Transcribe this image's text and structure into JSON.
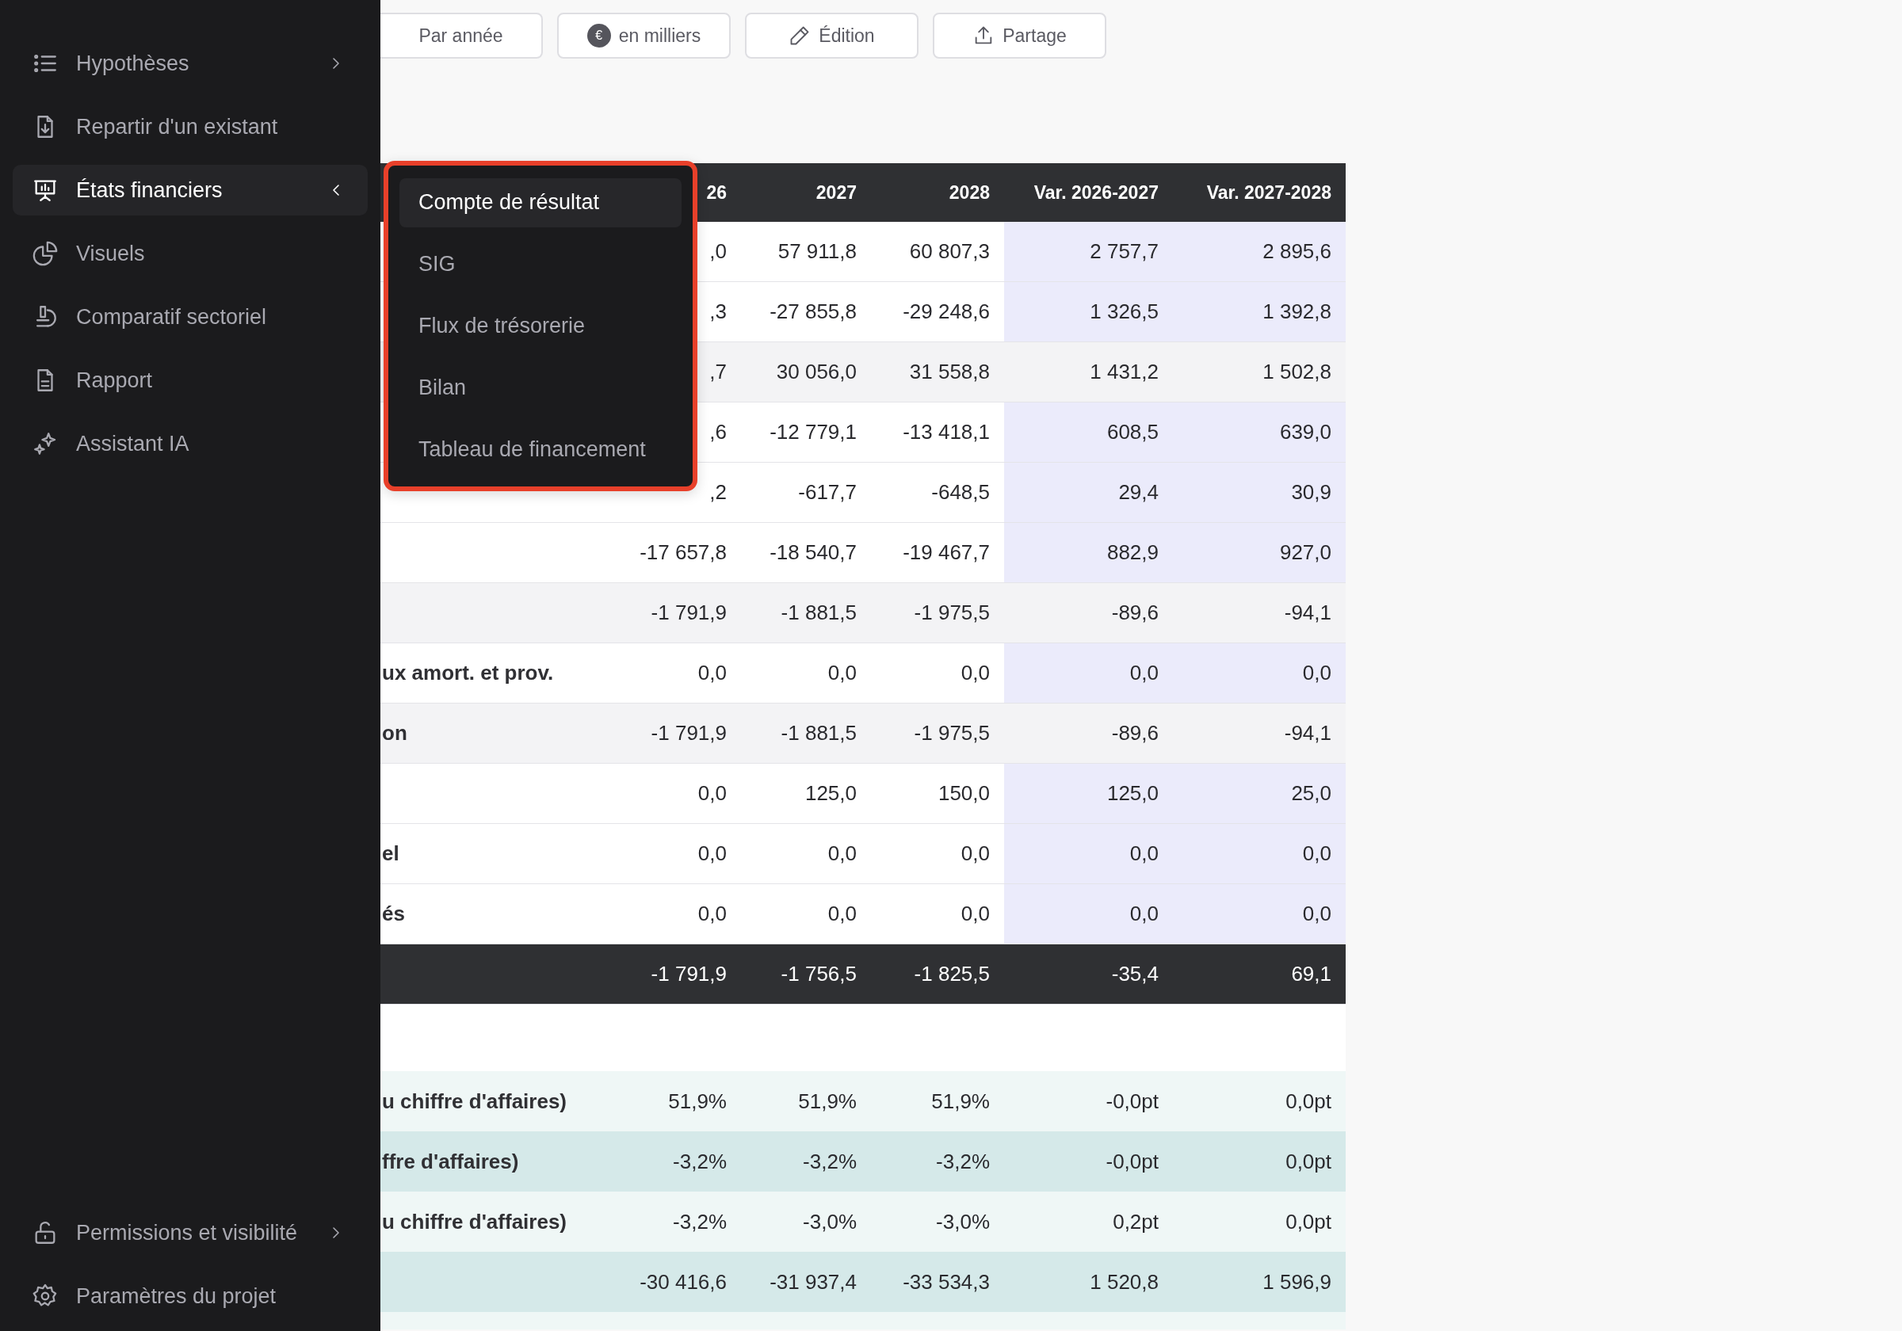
{
  "sidebar": {
    "items": [
      {
        "label": "Hypothèses",
        "selected": false,
        "expanded": false
      },
      {
        "label": "Repartir d'un existant",
        "selected": false
      },
      {
        "label": "États financiers",
        "selected": true,
        "expanded": true
      },
      {
        "label": "Visuels",
        "selected": false
      },
      {
        "label": "Comparatif sectoriel",
        "selected": false
      },
      {
        "label": "Rapport",
        "selected": false
      },
      {
        "label": "Assistant IA",
        "selected": false
      }
    ],
    "footer_items": [
      {
        "label": "Permissions et visibilité",
        "selected": false,
        "expanded": false
      },
      {
        "label": "Paramètres du projet",
        "selected": false
      }
    ]
  },
  "toolbar": {
    "buttons": [
      {
        "label": "Par année"
      },
      {
        "label": "en milliers",
        "badge": "€"
      },
      {
        "label": "Édition"
      },
      {
        "label": "Partage"
      }
    ]
  },
  "dropdown": {
    "items": [
      {
        "label": "Compte de résultat",
        "selected": true
      },
      {
        "label": "SIG",
        "selected": false
      },
      {
        "label": "Flux de trésorerie",
        "selected": false
      },
      {
        "label": "Bilan",
        "selected": false
      },
      {
        "label": "Tableau de financement",
        "selected": false
      }
    ]
  },
  "table": {
    "columns": [
      "26",
      "2027",
      "2028",
      "Var. 2026-2027",
      "Var. 2027-2028"
    ],
    "rows": [
      {
        "kind": "line",
        "cells": [
          ",0",
          "57 911,8",
          "60 807,3",
          "2 757,7",
          "2 895,6"
        ]
      },
      {
        "kind": "line",
        "cells": [
          ",3",
          "-27 855,8",
          "-29 248,6",
          "1 326,5",
          "1 392,8"
        ]
      },
      {
        "kind": "subtotal",
        "cells": [
          ",7",
          "30 056,0",
          "31 558,8",
          "1 431,2",
          "1 502,8"
        ]
      },
      {
        "kind": "line",
        "cells": [
          ",6",
          "-12 779,1",
          "-13 418,1",
          "608,5",
          "639,0"
        ]
      },
      {
        "kind": "line",
        "cells": [
          ",2",
          "-617,7",
          "-648,5",
          "29,4",
          "30,9"
        ]
      },
      {
        "kind": "line",
        "cells": [
          "-17 657,8",
          "-18 540,7",
          "-19 467,7",
          "882,9",
          "927,0"
        ]
      },
      {
        "kind": "subtotal",
        "cells": [
          "-1 791,9",
          "-1 881,5",
          "-1 975,5",
          "-89,6",
          "-94,1"
        ]
      },
      {
        "kind": "line",
        "label": "ux amort. et prov.",
        "cells": [
          "0,0",
          "0,0",
          "0,0",
          "0,0",
          "0,0"
        ]
      },
      {
        "kind": "subtotal",
        "label": "on",
        "cells": [
          "-1 791,9",
          "-1 881,5",
          "-1 975,5",
          "-89,6",
          "-94,1"
        ]
      },
      {
        "kind": "line",
        "cells": [
          "0,0",
          "125,0",
          "150,0",
          "125,0",
          "25,0"
        ]
      },
      {
        "kind": "line",
        "label": "el",
        "cells": [
          "0,0",
          "0,0",
          "0,0",
          "0,0",
          "0,0"
        ]
      },
      {
        "kind": "line",
        "label": "és",
        "cells": [
          "0,0",
          "0,0",
          "0,0",
          "0,0",
          "0,0"
        ]
      },
      {
        "kind": "total",
        "cells": [
          "-1 791,9",
          "-1 756,5",
          "-1 825,5",
          "-35,4",
          "69,1"
        ]
      },
      {
        "kind": "spacer"
      },
      {
        "kind": "ratio",
        "label": "u chiffre d'affaires)",
        "cells": [
          "51,9%",
          "51,9%",
          "51,9%",
          "-0,0pt",
          "0,0pt"
        ]
      },
      {
        "kind": "ratio-strong",
        "label": "ffre d'affaires)",
        "cells": [
          "-3,2%",
          "-3,2%",
          "-3,2%",
          "-0,0pt",
          "0,0pt"
        ]
      },
      {
        "kind": "ratio",
        "label": "u chiffre d'affaires)",
        "cells": [
          "-3,2%",
          "-3,0%",
          "-3,0%",
          "0,2pt",
          "0,0pt"
        ]
      },
      {
        "kind": "ratio-strong",
        "cells": [
          "-30 416,6",
          "-31 937,4",
          "-33 534,3",
          "1 520,8",
          "1 596,9"
        ]
      },
      {
        "kind": "ratio"
      }
    ]
  }
}
